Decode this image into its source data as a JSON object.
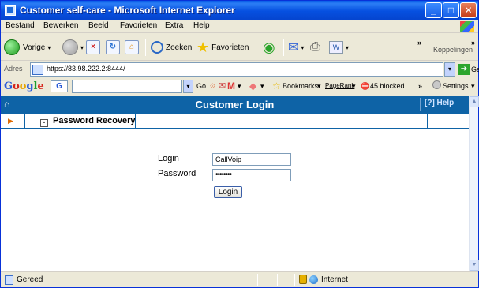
{
  "window": {
    "title": "Customer self-care - Microsoft Internet Explorer",
    "controls": {
      "minimize": "_",
      "maximize": "□",
      "close": "✕"
    }
  },
  "menu": [
    "Bestand",
    "Bewerken",
    "Beeld",
    "Favorieten",
    "Extra",
    "Help"
  ],
  "toolbar": {
    "back_label": "Vorige",
    "search_label": "Zoeken",
    "favorites_label": "Favorieten",
    "links_label": "Koppelingen"
  },
  "address": {
    "label": "Adres",
    "url": "https://83.98.222.2:8444/",
    "go_label": "Ga naar"
  },
  "google_toolbar": {
    "logo": [
      "G",
      "o",
      "o",
      "g",
      "l",
      "e"
    ],
    "g_button": "G",
    "go_label": "Go",
    "bookmarks_label": "Bookmarks",
    "pagerank_label": "PageRank",
    "blocked_label": "45 blocked",
    "settings_label": "Settings"
  },
  "page": {
    "header_title": "Customer Login",
    "help_label": "Help",
    "tab_label": "Password Recovery",
    "login_label": "Login",
    "password_label": "Password",
    "login_value": "CallVoip",
    "password_value": "••••••••",
    "login_button": "Login"
  },
  "status": {
    "text": "Gereed",
    "zone": "Internet"
  }
}
